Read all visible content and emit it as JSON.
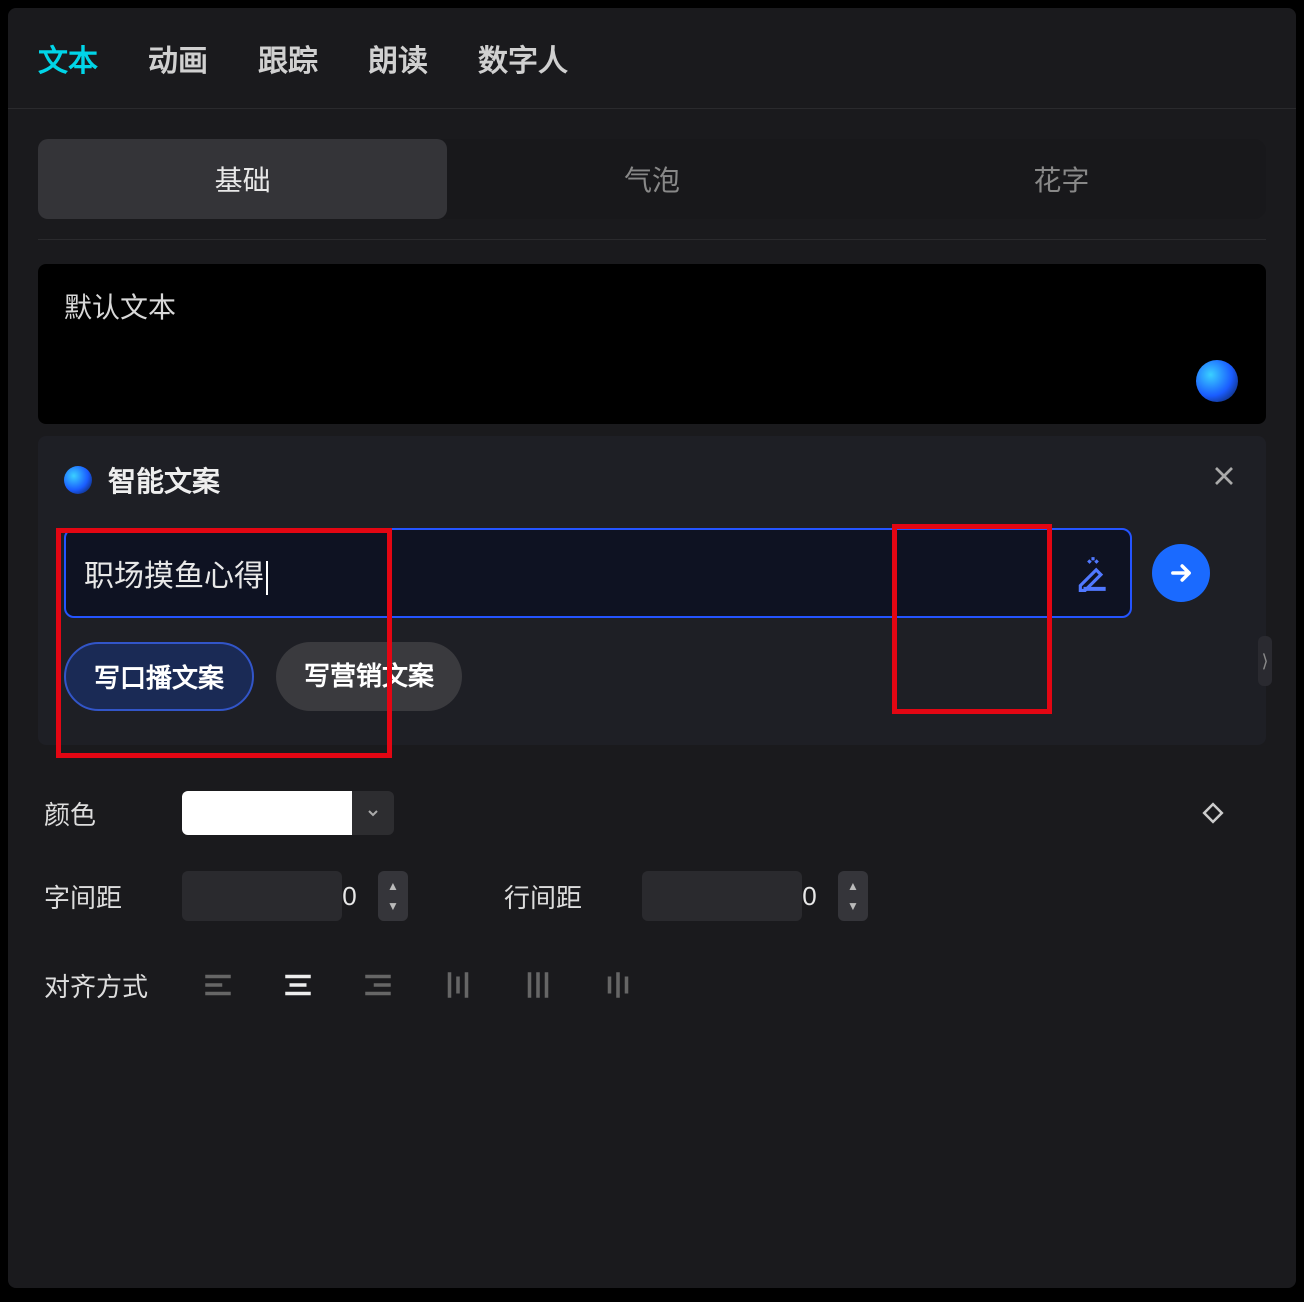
{
  "top_tabs": {
    "text": "文本",
    "animation": "动画",
    "tracking": "跟踪",
    "read": "朗读",
    "digital_human": "数字人"
  },
  "sub_tabs": {
    "basic": "基础",
    "bubble": "气泡",
    "fancy": "花字"
  },
  "text_box": {
    "placeholder": "默认文本"
  },
  "smart_panel": {
    "title": "智能文案",
    "input_value": "职场摸鱼心得",
    "chip_primary": "写口播文案",
    "chip_secondary": "写营销文案"
  },
  "props": {
    "color_label": "颜色",
    "letter_spacing_label": "字间距",
    "letter_spacing_value": "0",
    "line_spacing_label": "行间距",
    "line_spacing_value": "0",
    "align_label": "对齐方式"
  },
  "colors": {
    "swatch": "#ffffff"
  }
}
